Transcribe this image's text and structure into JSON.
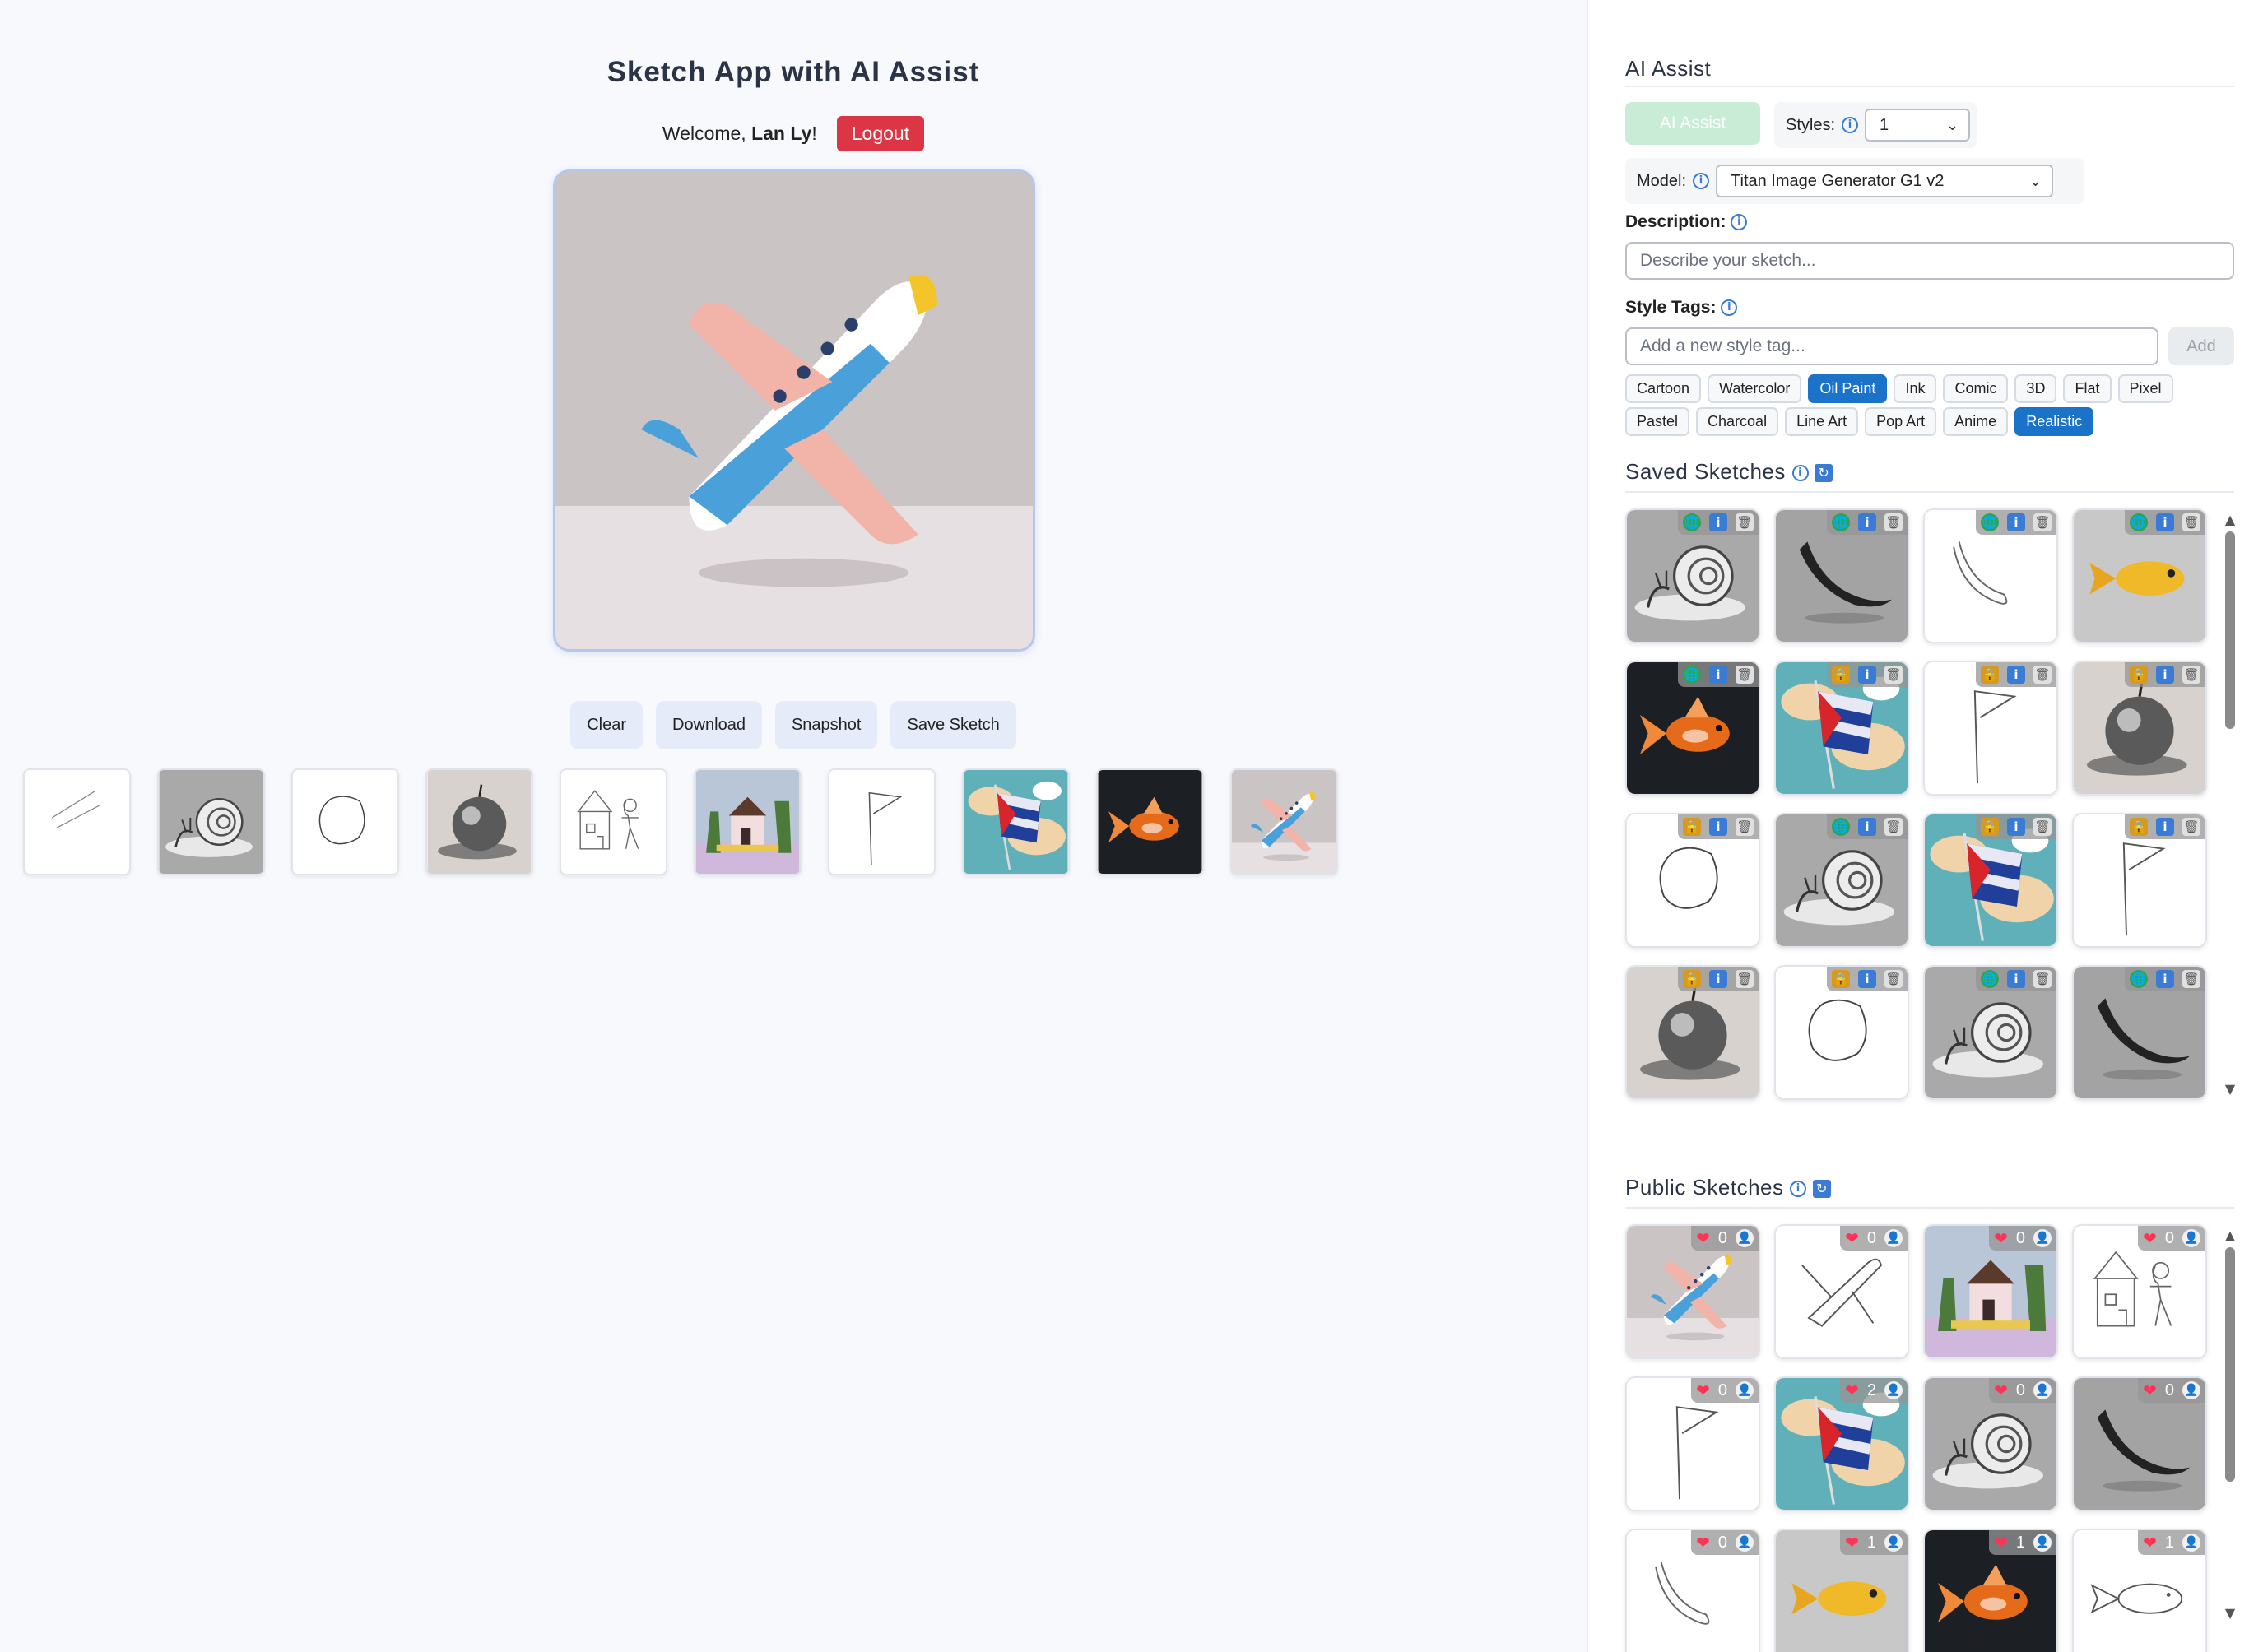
{
  "app": {
    "title": "Sketch App with AI Assist",
    "welcome_prefix": "Welcome,",
    "user_name": "Lan Ly",
    "welcome_suffix": "!",
    "logout_label": "Logout"
  },
  "canvas": {
    "image": "airplane"
  },
  "actions": {
    "clear": "Clear",
    "download": "Download",
    "snapshot": "Snapshot",
    "save": "Save Sketch"
  },
  "history": [
    "line",
    "snail",
    "circle",
    "apple",
    "house-sketch",
    "house",
    "flag-sketch",
    "flag",
    "fish-dark",
    "airplane"
  ],
  "ai_assist": {
    "heading": "AI Assist",
    "button_label": "AI Assist",
    "styles_label": "Styles:",
    "styles_value": "1",
    "model_label": "Model:",
    "model_value": "Titan Image Generator G1 v2",
    "description_label": "Description:",
    "description_placeholder": "Describe your sketch...",
    "style_tags_label": "Style Tags:",
    "style_tag_placeholder": "Add a new style tag...",
    "add_label": "Add",
    "tags_row1": [
      {
        "label": "Cartoon",
        "active": false
      },
      {
        "label": "Watercolor",
        "active": false
      },
      {
        "label": "Oil Paint",
        "active": true
      },
      {
        "label": "Ink",
        "active": false
      },
      {
        "label": "Comic",
        "active": false
      },
      {
        "label": "3D",
        "active": false
      },
      {
        "label": "Flat",
        "active": false
      },
      {
        "label": "Pixel",
        "active": false
      }
    ],
    "tags_row2": [
      {
        "label": "Pastel",
        "active": false
      },
      {
        "label": "Charcoal",
        "active": false
      },
      {
        "label": "Line Art",
        "active": false
      },
      {
        "label": "Pop Art",
        "active": false
      },
      {
        "label": "Anime",
        "active": false
      },
      {
        "label": "Realistic",
        "active": true
      }
    ]
  },
  "saved_sketches": {
    "heading": "Saved Sketches",
    "items": [
      {
        "image": "snail",
        "visibility": "public"
      },
      {
        "image": "banana",
        "visibility": "public"
      },
      {
        "image": "banana-sketch",
        "visibility": "public"
      },
      {
        "image": "fish-yellow",
        "visibility": "public"
      },
      {
        "image": "fish-dark",
        "visibility": "public"
      },
      {
        "image": "flag",
        "visibility": "private"
      },
      {
        "image": "flag-sketch",
        "visibility": "private"
      },
      {
        "image": "apple",
        "visibility": "private"
      },
      {
        "image": "circle",
        "visibility": "private"
      },
      {
        "image": "snail",
        "visibility": "public"
      },
      {
        "image": "flag",
        "visibility": "private"
      },
      {
        "image": "flag-sketch",
        "visibility": "private"
      },
      {
        "image": "apple",
        "visibility": "private"
      },
      {
        "image": "circle",
        "visibility": "private"
      },
      {
        "image": "snail",
        "visibility": "public"
      },
      {
        "image": "banana",
        "visibility": "public"
      }
    ]
  },
  "public_sketches": {
    "heading": "Public Sketches",
    "items": [
      {
        "image": "airplane",
        "likes": "0"
      },
      {
        "image": "airplane-sketch",
        "likes": "0"
      },
      {
        "image": "house",
        "likes": "0"
      },
      {
        "image": "house-sketch",
        "likes": "0"
      },
      {
        "image": "flag-sketch",
        "likes": "0"
      },
      {
        "image": "flag",
        "likes": "2"
      },
      {
        "image": "snail",
        "likes": "0"
      },
      {
        "image": "banana",
        "likes": "0"
      },
      {
        "image": "banana-sketch",
        "likes": "0"
      },
      {
        "image": "fish-yellow",
        "likes": "1"
      },
      {
        "image": "fish-dark",
        "likes": "1"
      },
      {
        "image": "fish-sketch",
        "likes": "1"
      }
    ]
  },
  "icons": {
    "info": "info-icon",
    "refresh": "refresh-icon",
    "globe": "globe-icon",
    "lock": "lock-icon",
    "trash": "trash-icon",
    "heart": "heart-icon",
    "user": "user-icon",
    "chevron": "chevron-down-icon"
  },
  "colors": {
    "logout": "#dc3545",
    "tag_active": "#1a73c9",
    "ai_assist_disabled": "#c9ecd6"
  }
}
